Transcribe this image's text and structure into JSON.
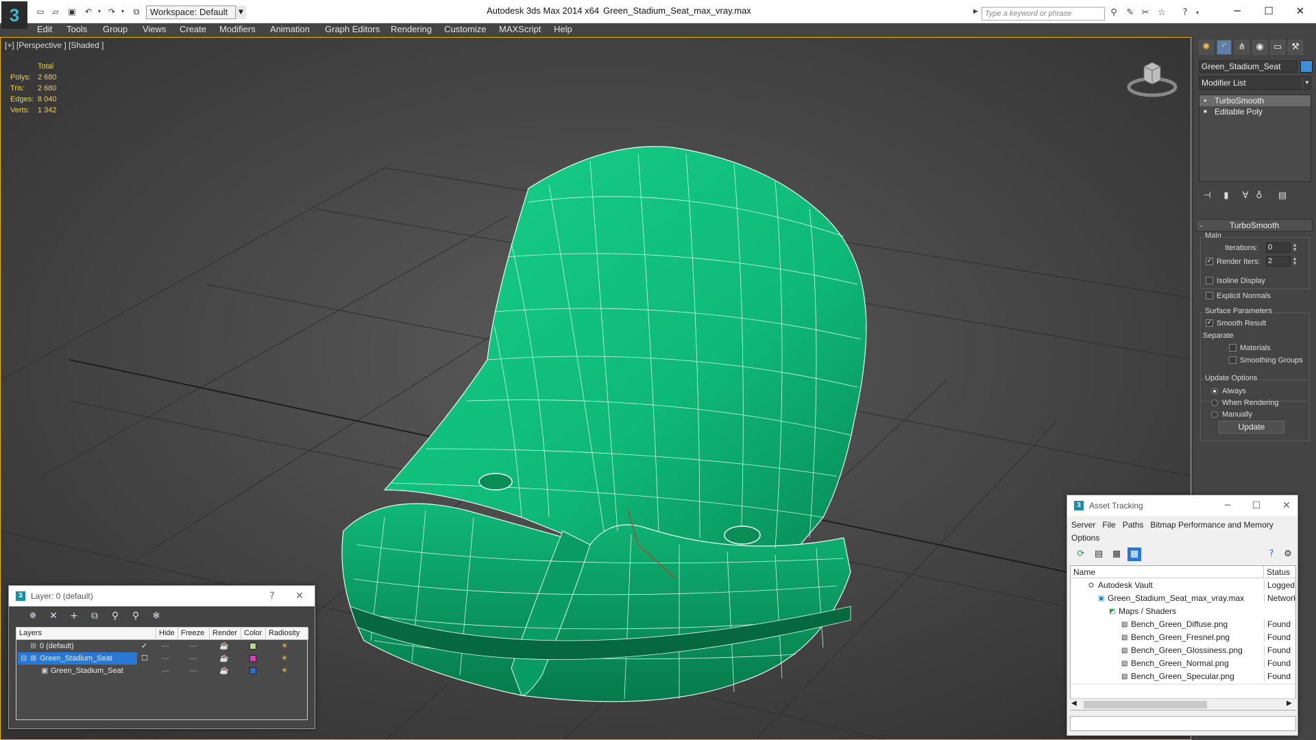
{
  "titlebar": {
    "app_logo": "3",
    "workspace": "Workspace: Default",
    "app_title": "Autodesk 3ds Max  2014 x64",
    "file_title": "Green_Stadium_Seat_max_vray.max",
    "search_placeholder": "Type a keyword or phrase"
  },
  "menu": [
    "Edit",
    "Tools",
    "Group",
    "Views",
    "Create",
    "Modifiers",
    "Animation",
    "Graph Editors",
    "Rendering",
    "Customize",
    "MAXScript",
    "Help"
  ],
  "viewport": {
    "label": "[+] [Perspective ] [Shaded ]",
    "stats_header": "Total",
    "stats": [
      {
        "label": "Polys:",
        "value": "2 680"
      },
      {
        "label": "Tris:",
        "value": "2 680"
      },
      {
        "label": "Edges:",
        "value": "8 040"
      },
      {
        "label": "Verts:",
        "value": "1 342"
      }
    ],
    "seat_color": "#12c27e",
    "stats_color": "#f0d24a",
    "selection_border": "#e8b400"
  },
  "command_panel": {
    "object_name": "Green_Stadium_Seat",
    "object_color": "#3d8fd9",
    "modifier_list": "Modifier List",
    "stack": [
      "TurboSmooth",
      "Editable Poly"
    ],
    "rollout_title": "TurboSmooth",
    "main_label": "Main",
    "iterations_label": "Iterations:",
    "iterations_value": "0",
    "render_iters_label": "Render Iters:",
    "render_iters_value": "2",
    "isoline_label": "Isoline Display",
    "explicit_normals_label": "Explicit Normals",
    "surface_params_label": "Surface Parameters",
    "smooth_result_label": "Smooth Result",
    "separate_label": "Separate",
    "materials_label": "Materials",
    "smoothing_groups_label": "Smoothing Groups",
    "update_options_label": "Update Options",
    "always_label": "Always",
    "when_rendering_label": "When Rendering",
    "manually_label": "Manually",
    "update_button": "Update"
  },
  "layer_dialog": {
    "title": "Layer: 0 (default)",
    "help": "?",
    "columns": [
      "Layers",
      "Hide",
      "Freeze",
      "Render",
      "Color",
      "Radiosity"
    ],
    "rows": [
      {
        "name": "0 (default)",
        "color": "#b8d88a"
      },
      {
        "name": "Green_Stadium_Seat",
        "color": "#e040c0"
      },
      {
        "name": "Green_Stadium_Seat",
        "color": "#2a6fd0"
      }
    ]
  },
  "asset_dialog": {
    "title": "Asset Tracking",
    "menu": [
      "Server",
      "File",
      "Paths",
      "Bitmap Performance and Memory",
      "Options"
    ],
    "columns": [
      "Name",
      "Status"
    ],
    "rows": [
      {
        "name": "Autodesk Vault",
        "status": "Logged O"
      },
      {
        "name": "Green_Stadium_Seat_max_vray.max",
        "status": "Network"
      },
      {
        "name": "Maps / Shaders",
        "status": ""
      },
      {
        "name": "Bench_Green_Diffuse.png",
        "status": "Found"
      },
      {
        "name": "Bench_Green_Fresnel.png",
        "status": "Found"
      },
      {
        "name": "Bench_Green_Glossiness.png",
        "status": "Found"
      },
      {
        "name": "Bench_Green_Normal.png",
        "status": "Found"
      },
      {
        "name": "Bench_Green_Specular.png",
        "status": "Found"
      }
    ]
  }
}
